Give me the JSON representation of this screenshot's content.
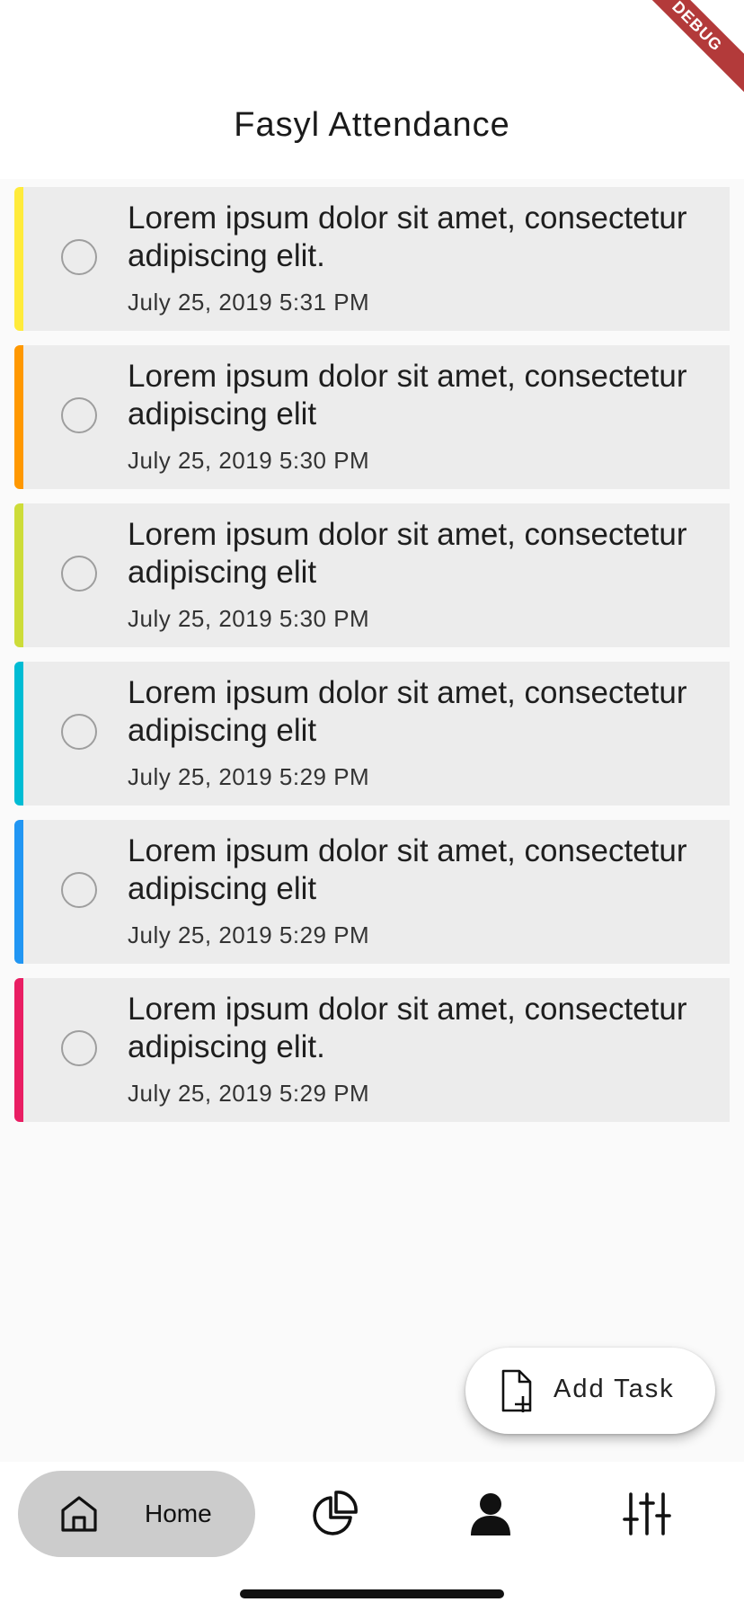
{
  "app": {
    "title": "Fasyl Attendance",
    "debug_banner": "DEBUG"
  },
  "tasks": [
    {
      "title": "Lorem ipsum dolor sit amet, consectetur adipiscing elit.",
      "date": "July 25, 2019 5:31 PM",
      "color": "#ffeb3b"
    },
    {
      "title": "Lorem ipsum dolor sit amet, consectetur adipiscing elit",
      "date": "July 25, 2019 5:30 PM",
      "color": "#ff9800"
    },
    {
      "title": "Lorem ipsum dolor sit amet, consectetur adipiscing elit",
      "date": "July 25, 2019 5:30 PM",
      "color": "#cddc39"
    },
    {
      "title": "Lorem ipsum dolor sit amet, consectetur adipiscing elit",
      "date": "July 25, 2019 5:29 PM",
      "color": "#00bcd4"
    },
    {
      "title": "Lorem ipsum dolor sit amet, consectetur adipiscing elit",
      "date": "July 25, 2019 5:29 PM",
      "color": "#2196f3"
    },
    {
      "title": "Lorem ipsum dolor sit amet, consectetur adipiscing elit.",
      "date": "July 25, 2019 5:29 PM",
      "color": "#e91e63"
    }
  ],
  "fab": {
    "label": "Add Task",
    "icon": "add-file-icon"
  },
  "nav": {
    "items": [
      {
        "label": "Home",
        "icon": "home-icon",
        "active": true
      },
      {
        "label": "",
        "icon": "pie-chart-icon",
        "active": false
      },
      {
        "label": "",
        "icon": "person-icon",
        "active": false
      },
      {
        "label": "",
        "icon": "sliders-icon",
        "active": false
      }
    ]
  }
}
